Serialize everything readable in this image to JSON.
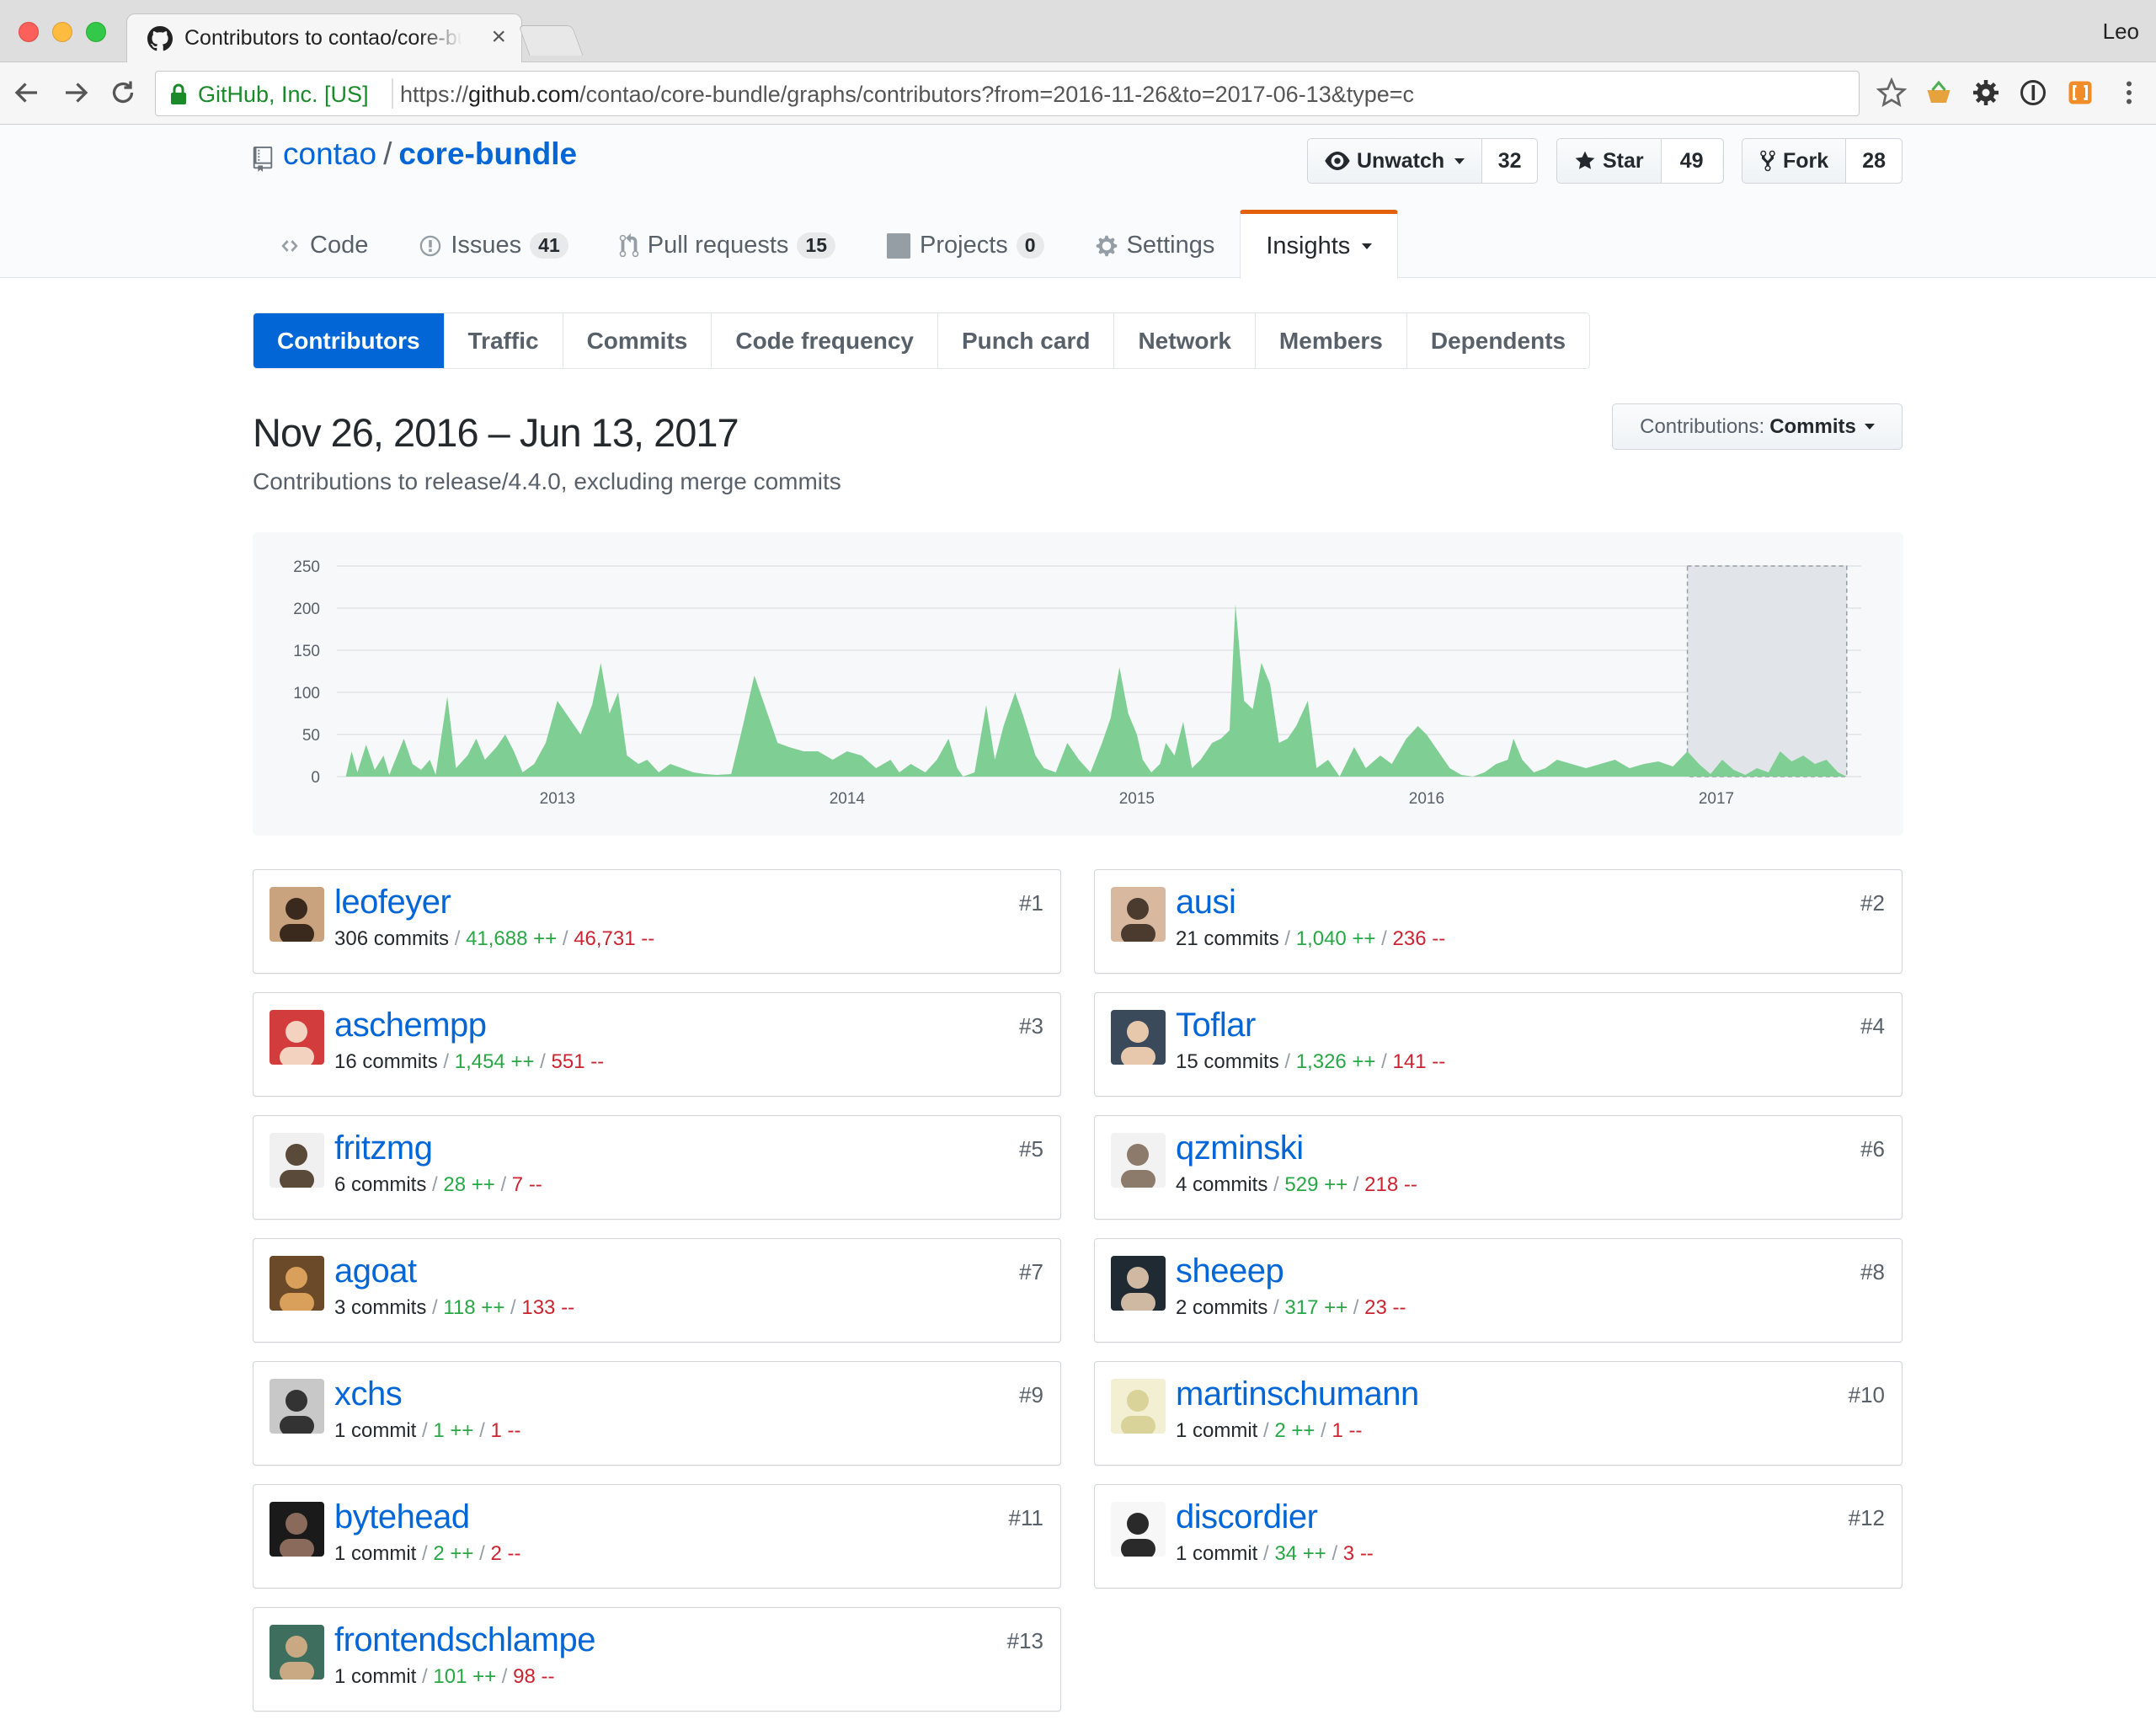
{
  "browser": {
    "tab_title": "Contributors to contao/core-bundle",
    "profile": "Leo",
    "org": "GitHub, Inc. [US]",
    "url_scheme": "https://",
    "url_host": "github.com",
    "url_path": "/contao/core-bundle/graphs/contributors?from=2016-11-26&to=2017-06-13&type=c"
  },
  "repo": {
    "owner": "contao",
    "separator": "/",
    "name": "core-bundle",
    "watch_label": "Unwatch",
    "watch_count": "32",
    "star_label": "Star",
    "star_count": "49",
    "fork_label": "Fork",
    "fork_count": "28"
  },
  "reponav": [
    {
      "label": "Code",
      "icon": "code-icon"
    },
    {
      "label": "Issues",
      "counter": "41",
      "icon": "issue-icon"
    },
    {
      "label": "Pull requests",
      "counter": "15",
      "icon": "pull-request-icon"
    },
    {
      "label": "Projects",
      "counter": "0",
      "icon": "project-icon"
    },
    {
      "label": "Settings",
      "icon": "gear-icon"
    },
    {
      "label": "Insights",
      "icon": "caret-down-icon",
      "selected": true
    }
  ],
  "subnav": [
    "Contributors",
    "Traffic",
    "Commits",
    "Code frequency",
    "Punch card",
    "Network",
    "Members",
    "Dependents"
  ],
  "range_title": "Nov 26, 2016 – Jun 13, 2017",
  "range_subtitle": "Contributions to release/4.4.0, excluding merge commits",
  "contrib_select": {
    "prefix": "Contributions:",
    "value": "Commits"
  },
  "chart_data": {
    "type": "area",
    "y_ticks": [
      "250",
      "200",
      "150",
      "100",
      "50",
      "0"
    ],
    "ylim": [
      0,
      250
    ],
    "x_ticks": [
      "2013",
      "2014",
      "2015",
      "2016",
      "2017"
    ],
    "x_tick_values": [
      2013,
      2014,
      2015,
      2016,
      2017
    ],
    "xlim": [
      2012.21,
      2017.5
    ],
    "selection": {
      "from": 2016.9,
      "to": 2017.45
    },
    "color": "#7fcf94",
    "points": [
      [
        2012.21,
        0
      ],
      [
        2012.27,
        0
      ],
      [
        2012.29,
        30
      ],
      [
        2012.31,
        5
      ],
      [
        2012.34,
        38
      ],
      [
        2012.37,
        8
      ],
      [
        2012.4,
        25
      ],
      [
        2012.42,
        2
      ],
      [
        2012.47,
        45
      ],
      [
        2012.5,
        15
      ],
      [
        2012.53,
        8
      ],
      [
        2012.56,
        20
      ],
      [
        2012.58,
        2
      ],
      [
        2012.62,
        95
      ],
      [
        2012.65,
        10
      ],
      [
        2012.69,
        25
      ],
      [
        2012.72,
        45
      ],
      [
        2012.75,
        20
      ],
      [
        2012.79,
        35
      ],
      [
        2012.82,
        50
      ],
      [
        2012.85,
        30
      ],
      [
        2012.88,
        5
      ],
      [
        2012.92,
        15
      ],
      [
        2012.96,
        40
      ],
      [
        2013.0,
        90
      ],
      [
        2013.04,
        70
      ],
      [
        2013.08,
        50
      ],
      [
        2013.12,
        85
      ],
      [
        2013.15,
        135
      ],
      [
        2013.18,
        75
      ],
      [
        2013.21,
        100
      ],
      [
        2013.24,
        25
      ],
      [
        2013.28,
        15
      ],
      [
        2013.31,
        20
      ],
      [
        2013.35,
        5
      ],
      [
        2013.39,
        15
      ],
      [
        2013.43,
        10
      ],
      [
        2013.47,
        5
      ],
      [
        2013.51,
        3
      ],
      [
        2013.55,
        2
      ],
      [
        2013.6,
        3
      ],
      [
        2013.64,
        60
      ],
      [
        2013.68,
        120
      ],
      [
        2013.72,
        80
      ],
      [
        2013.76,
        40
      ],
      [
        2013.8,
        35
      ],
      [
        2013.85,
        30
      ],
      [
        2013.9,
        30
      ],
      [
        2013.95,
        20
      ],
      [
        2014.0,
        30
      ],
      [
        2014.05,
        25
      ],
      [
        2014.1,
        10
      ],
      [
        2014.15,
        20
      ],
      [
        2014.18,
        5
      ],
      [
        2014.22,
        15
      ],
      [
        2014.27,
        5
      ],
      [
        2014.31,
        20
      ],
      [
        2014.35,
        45
      ],
      [
        2014.38,
        10
      ],
      [
        2014.4,
        0
      ],
      [
        2014.44,
        5
      ],
      [
        2014.48,
        85
      ],
      [
        2014.51,
        20
      ],
      [
        2014.54,
        60
      ],
      [
        2014.58,
        100
      ],
      [
        2014.61,
        70
      ],
      [
        2014.65,
        25
      ],
      [
        2014.68,
        10
      ],
      [
        2014.72,
        5
      ],
      [
        2014.76,
        40
      ],
      [
        2014.8,
        20
      ],
      [
        2014.84,
        5
      ],
      [
        2014.88,
        40
      ],
      [
        2014.91,
        70
      ],
      [
        2014.94,
        130
      ],
      [
        2014.97,
        75
      ],
      [
        2015.0,
        50
      ],
      [
        2015.02,
        20
      ],
      [
        2015.05,
        5
      ],
      [
        2015.08,
        15
      ],
      [
        2015.1,
        40
      ],
      [
        2015.13,
        25
      ],
      [
        2015.16,
        65
      ],
      [
        2015.19,
        10
      ],
      [
        2015.22,
        20
      ],
      [
        2015.26,
        40
      ],
      [
        2015.29,
        45
      ],
      [
        2015.32,
        55
      ],
      [
        2015.34,
        205
      ],
      [
        2015.37,
        90
      ],
      [
        2015.4,
        80
      ],
      [
        2015.43,
        135
      ],
      [
        2015.46,
        110
      ],
      [
        2015.49,
        40
      ],
      [
        2015.52,
        45
      ],
      [
        2015.55,
        60
      ],
      [
        2015.59,
        90
      ],
      [
        2015.62,
        10
      ],
      [
        2015.66,
        20
      ],
      [
        2015.7,
        0
      ],
      [
        2015.75,
        35
      ],
      [
        2015.79,
        10
      ],
      [
        2015.84,
        25
      ],
      [
        2015.88,
        15
      ],
      [
        2015.93,
        45
      ],
      [
        2015.97,
        60
      ],
      [
        2016.0,
        50
      ],
      [
        2016.04,
        30
      ],
      [
        2016.08,
        10
      ],
      [
        2016.12,
        2
      ],
      [
        2016.16,
        0
      ],
      [
        2016.2,
        5
      ],
      [
        2016.24,
        15
      ],
      [
        2016.28,
        20
      ],
      [
        2016.3,
        45
      ],
      [
        2016.33,
        20
      ],
      [
        2016.37,
        5
      ],
      [
        2016.41,
        10
      ],
      [
        2016.45,
        20
      ],
      [
        2016.5,
        15
      ],
      [
        2016.55,
        10
      ],
      [
        2016.6,
        15
      ],
      [
        2016.65,
        20
      ],
      [
        2016.7,
        10
      ],
      [
        2016.75,
        15
      ],
      [
        2016.8,
        18
      ],
      [
        2016.85,
        12
      ],
      [
        2016.9,
        30
      ],
      [
        2016.94,
        15
      ],
      [
        2016.98,
        3
      ],
      [
        2017.02,
        20
      ],
      [
        2017.06,
        8
      ],
      [
        2017.1,
        2
      ],
      [
        2017.14,
        10
      ],
      [
        2017.18,
        5
      ],
      [
        2017.22,
        30
      ],
      [
        2017.26,
        18
      ],
      [
        2017.3,
        25
      ],
      [
        2017.34,
        15
      ],
      [
        2017.38,
        20
      ],
      [
        2017.42,
        5
      ],
      [
        2017.45,
        0
      ]
    ]
  },
  "contributors": [
    {
      "name": "leofeyer",
      "commits": "306 commits",
      "add": "41,688 ++",
      "del": "46,731 --",
      "rank": "#1"
    },
    {
      "name": "ausi",
      "commits": "21 commits",
      "add": "1,040 ++",
      "del": "236 --",
      "rank": "#2"
    },
    {
      "name": "aschempp",
      "commits": "16 commits",
      "add": "1,454 ++",
      "del": "551 --",
      "rank": "#3"
    },
    {
      "name": "Toflar",
      "commits": "15 commits",
      "add": "1,326 ++",
      "del": "141 --",
      "rank": "#4"
    },
    {
      "name": "fritzmg",
      "commits": "6 commits",
      "add": "28 ++",
      "del": "7 --",
      "rank": "#5"
    },
    {
      "name": "qzminski",
      "commits": "4 commits",
      "add": "529 ++",
      "del": "218 --",
      "rank": "#6"
    },
    {
      "name": "agoat",
      "commits": "3 commits",
      "add": "118 ++",
      "del": "133 --",
      "rank": "#7"
    },
    {
      "name": "sheeep",
      "commits": "2 commits",
      "add": "317 ++",
      "del": "23 --",
      "rank": "#8"
    },
    {
      "name": "xchs",
      "commits": "1 commit",
      "add": "1 ++",
      "del": "1 --",
      "rank": "#9"
    },
    {
      "name": "martinschumann",
      "commits": "1 commit",
      "add": "2 ++",
      "del": "1 --",
      "rank": "#10"
    },
    {
      "name": "bytehead",
      "commits": "1 commit",
      "add": "2 ++",
      "del": "2 --",
      "rank": "#11"
    },
    {
      "name": "discordier",
      "commits": "1 commit",
      "add": "34 ++",
      "del": "3 --",
      "rank": "#12"
    },
    {
      "name": "frontendschlampe",
      "commits": "1 commit",
      "add": "101 ++",
      "del": "98 --",
      "rank": "#13"
    }
  ]
}
